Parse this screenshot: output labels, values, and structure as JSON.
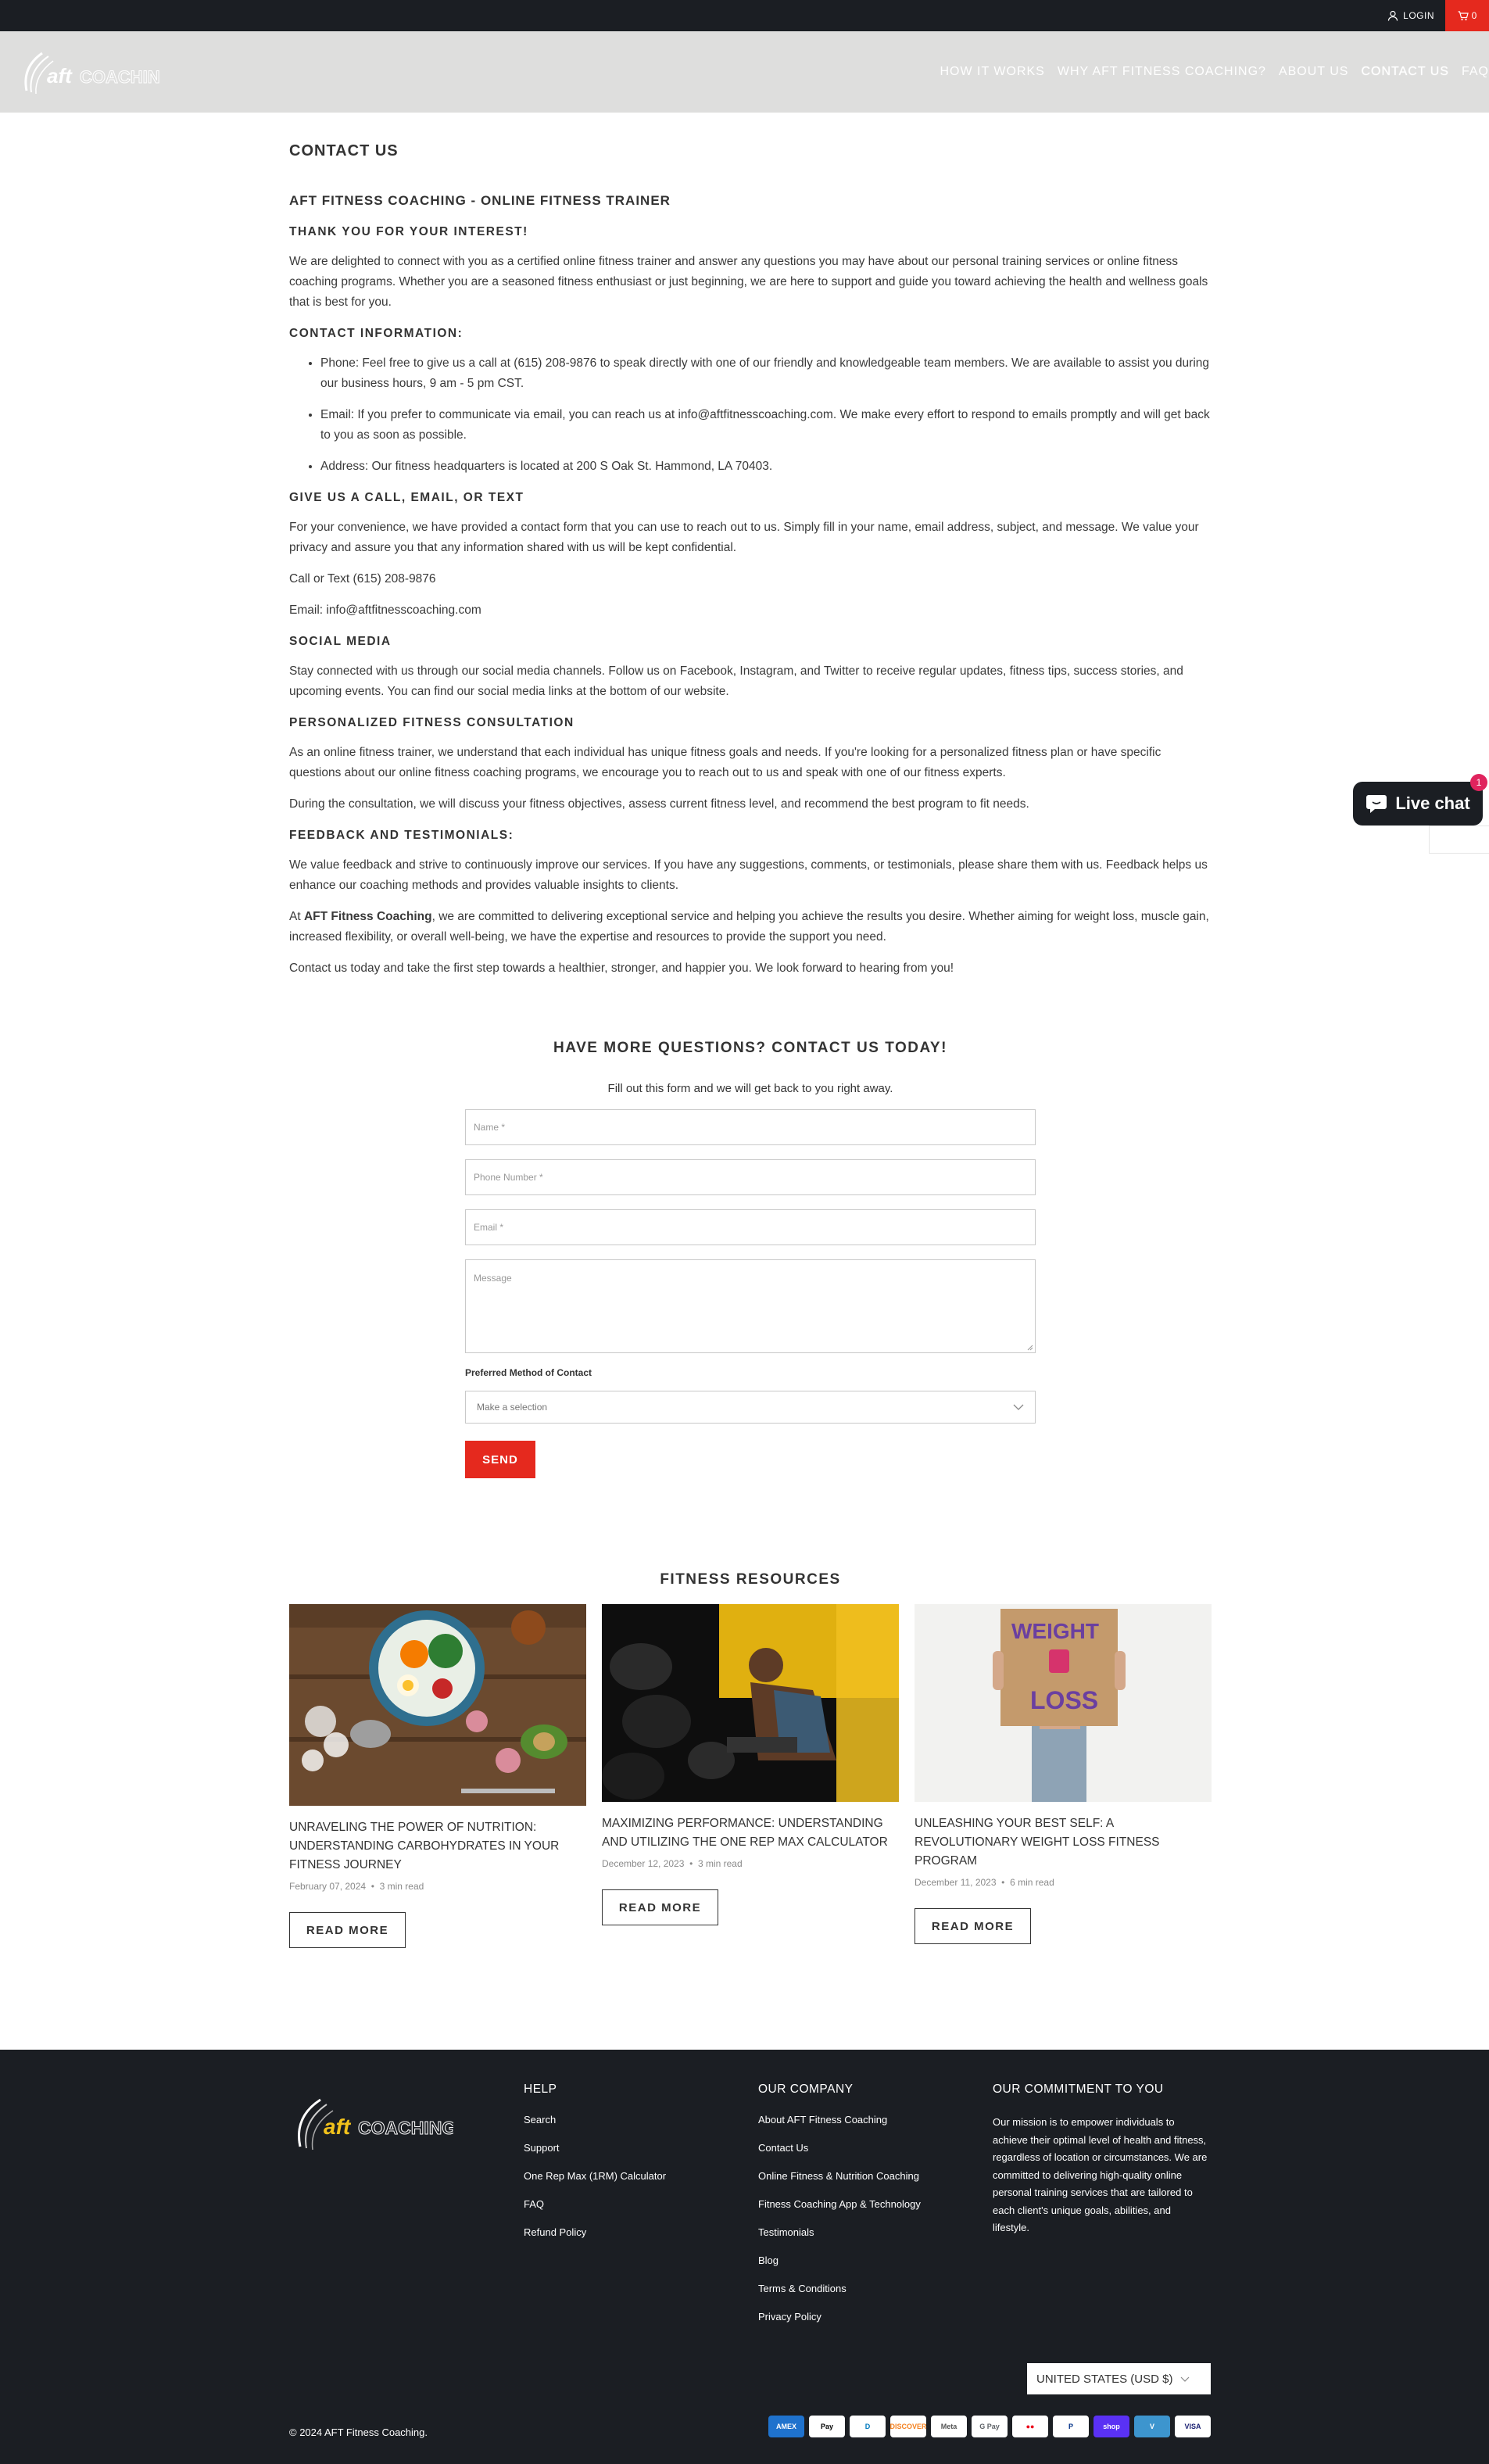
{
  "topbar": {
    "login_label": "LOGIN",
    "cart_count": "0"
  },
  "header": {
    "logo_text": "aftCOACHING",
    "nav": [
      {
        "label": "HOW IT WORKS"
      },
      {
        "label": "WHY AFT FITNESS COACHING?"
      },
      {
        "label": "ABOUT US"
      },
      {
        "label": "CONTACT US"
      },
      {
        "label": "FAQ"
      }
    ]
  },
  "page": {
    "title": "CONTACT US",
    "heading": "AFT FITNESS COACHING - ONLINE FITNESS TRAINER",
    "thanks_heading": "THANK YOU FOR YOUR INTEREST!",
    "intro": "We are delighted to connect with you as a certified online fitness trainer and answer any questions you may have about our personal training services or online fitness coaching programs. Whether you are a seasoned fitness enthusiast or just beginning, we are here to support and guide you toward achieving the health and wellness goals that is best for you.",
    "contact_heading": "CONTACT INFORMATION:",
    "contact_items": [
      "Phone: Feel free to give us a call at (615) 208-9876 to speak directly with one of our friendly and knowledgeable team members. We are available to assist you during our business hours, 9 am - 5 pm CST.",
      "Email: If you prefer to communicate via email, you can reach us at info@aftfitnesscoaching.com. We make every effort to respond to emails promptly and will get back to you as soon as possible.",
      "Address: Our fitness headquarters is located at 200 S Oak St. Hammond, LA 70403."
    ],
    "call_heading": "GIVE US A CALL, EMAIL, OR TEXT",
    "call_text": "For your convenience, we have provided a contact form that you can use to reach out to us. Simply fill in your name, email address, subject, and message. We value your privacy and assure you that any information shared with us will be kept confidential.",
    "call_or_text": "Call or Text (615) 208-9876",
    "email_line": "Email: info@aftfitnesscoaching.com",
    "social_heading": "SOCIAL MEDIA",
    "social_text": "Stay connected with us through our social media channels. Follow us on Facebook, Instagram, and Twitter to receive regular updates, fitness tips, success stories, and upcoming events. You can find our social media links at the bottom of our website.",
    "consult_heading": "PERSONALIZED FITNESS CONSULTATION",
    "consult_text1": "As an online fitness trainer, we understand that each individual has unique fitness goals and needs. If you're looking for a personalized fitness plan or have specific questions about our online fitness coaching programs, we encourage you to reach out to us and speak with one of our fitness experts.",
    "consult_text2": "During the consultation, we will discuss your fitness objectives, assess current fitness level, and recommend the best program to fit needs.",
    "feedback_heading": "FEEDBACK AND TESTIMONIALS:",
    "feedback_text": "We value feedback and strive to continuously improve our services. If you have any suggestions, comments, or testimonials, please share them with us. Feedback helps us enhance our coaching methods and provides valuable insights to clients.",
    "commit_prefix": "At ",
    "commit_brand": "AFT Fitness Coaching",
    "commit_suffix": ", we are committed to delivering exceptional service and helping you achieve the results you desire. Whether aiming for weight loss, muscle gain, increased flexibility, or overall well-being, we have the expertise and resources to provide the support you need.",
    "closing": "Contact us today and take the first step towards a healthier, stronger, and happier you. We look forward to hearing from you!"
  },
  "form": {
    "title": "HAVE MORE QUESTIONS? CONTACT US TODAY!",
    "subtitle": "Fill out this form and we will get back to you right away.",
    "name_placeholder": "Name *",
    "phone_placeholder": "Phone Number *",
    "email_placeholder": "Email *",
    "message_placeholder": "Message",
    "pref_label": "Preferred Method of Contact",
    "select_value": "Make a selection",
    "send_label": "SEND"
  },
  "resources": {
    "title": "FITNESS RESOURCES",
    "posts": [
      {
        "title": "UNRAVELING THE POWER OF NUTRITION: UNDERSTANDING CARBOHYDRATES IN YOUR FITNESS JOURNEY",
        "date": "February 07, 2024",
        "read": "3 min read",
        "cta": "READ MORE"
      },
      {
        "title": "MAXIMIZING PERFORMANCE: UNDERSTANDING AND UTILIZING THE ONE REP MAX CALCULATOR",
        "date": "December 12, 2023",
        "read": "3 min read",
        "cta": "READ MORE"
      },
      {
        "title": "UNLEASHING YOUR BEST SELF: A REVOLUTIONARY WEIGHT LOSS FITNESS PROGRAM",
        "date": "December 11, 2023",
        "read": "6 min read",
        "cta": "READ MORE"
      }
    ],
    "sign_top": "WEIGHT",
    "sign_bottom": "LOSS"
  },
  "footer": {
    "help_heading": "HELP",
    "help_links": [
      "Search",
      "Support",
      "One Rep Max (1RM) Calculator",
      "FAQ",
      "Refund Policy"
    ],
    "company_heading": "OUR COMPANY",
    "company_links": [
      "About AFT Fitness Coaching",
      "Contact Us",
      "Online Fitness & Nutrition Coaching",
      "Fitness Coaching App & Technology",
      "Testimonials",
      "Blog",
      "Terms & Conditions",
      "Privacy Policy"
    ],
    "commitment_heading": "OUR COMMITMENT TO YOU",
    "commitment_text": "Our mission is to empower individuals to achieve their optimal level of health and fitness, regardless of location or circumstances. We are committed to delivering high-quality online personal training services that are tailored to each client's unique goals, abilities, and lifestyle.",
    "currency": "UNITED STATES (USD $)",
    "copyright": "© 2024 AFT Fitness Coaching.",
    "payments": [
      {
        "label": "AMEX",
        "bg": "#1f72cd",
        "fg": "#ffffff"
      },
      {
        "label": "Pay",
        "bg": "#ffffff",
        "fg": "#000000"
      },
      {
        "label": "D",
        "bg": "#ffffff",
        "fg": "#0079be"
      },
      {
        "label": "DISCOVER",
        "bg": "#ffffff",
        "fg": "#f58220"
      },
      {
        "label": "Meta",
        "bg": "#ffffff",
        "fg": "#555555"
      },
      {
        "label": "G Pay",
        "bg": "#ffffff",
        "fg": "#5f6368"
      },
      {
        "label": "●●",
        "bg": "#ffffff",
        "fg": "#eb001b"
      },
      {
        "label": "P",
        "bg": "#ffffff",
        "fg": "#003087"
      },
      {
        "label": "shop",
        "bg": "#5a31f4",
        "fg": "#ffffff"
      },
      {
        "label": "V",
        "bg": "#3d95ce",
        "fg": "#ffffff"
      },
      {
        "label": "VISA",
        "bg": "#ffffff",
        "fg": "#1a1f71"
      }
    ]
  },
  "chat": {
    "label": "Live chat",
    "badge": "1"
  }
}
